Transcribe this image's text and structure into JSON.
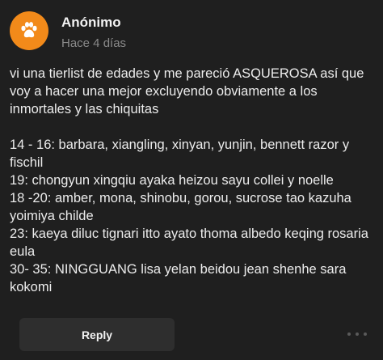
{
  "post": {
    "author": "Anónimo",
    "time": "Hace 4 días",
    "intro": "vi una tierlist de edades y me pareció ASQUEROSA así que voy a hacer una mejor excluyendo obviamente a los inmortales y las chiquitas",
    "lines": [
      "14 - 16: barbara, xiangling, xinyan, yunjin, bennett razor y fischil",
      "19: chongyun xingqiu ayaka heizou sayu collei y noelle",
      "18 -20: amber, mona, shinobu, gorou, sucrose tao kazuha yoimiya childe",
      "23: kaeya diluc tignari itto ayato thoma albedo keqing rosaria eula",
      "30- 35: NINGGUANG lisa yelan beidou jean shenhe sara kokomi"
    ]
  },
  "footer": {
    "reply_label": "Reply"
  },
  "icons": {
    "avatar": "paw-icon",
    "more": "more-options-icon"
  },
  "colors": {
    "background": "#1f1f1f",
    "avatar": "#f28a1a",
    "reply_button": "#2e2e2e"
  }
}
